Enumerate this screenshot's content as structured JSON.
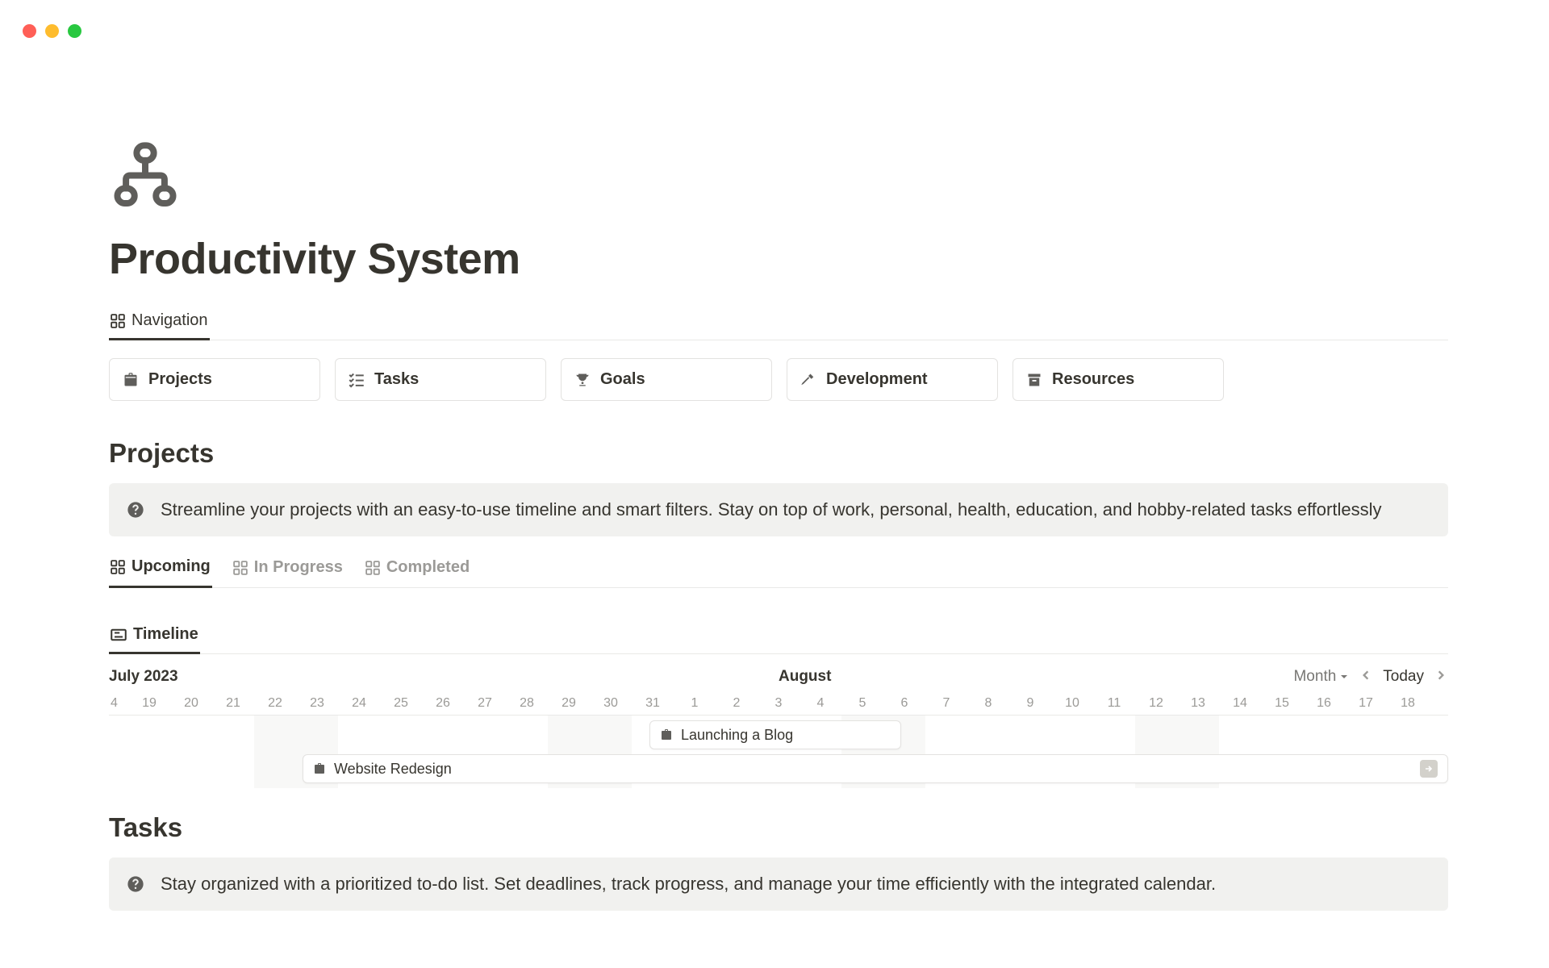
{
  "page": {
    "title": "Productivity System"
  },
  "nav_tab": {
    "label": "Navigation"
  },
  "cards": [
    {
      "label": "Projects"
    },
    {
      "label": "Tasks"
    },
    {
      "label": "Goals"
    },
    {
      "label": "Development"
    },
    {
      "label": "Resources"
    }
  ],
  "projects": {
    "heading": "Projects",
    "callout": "Streamline your projects with an easy-to-use timeline and smart filters. Stay on top of work, personal, health, education, and hobby-related tasks effortlessly",
    "views": [
      {
        "label": "Upcoming"
      },
      {
        "label": "In Progress"
      },
      {
        "label": "Completed"
      }
    ],
    "timeline_tab": {
      "label": "Timeline"
    },
    "timeline": {
      "month1": "July 2023",
      "month2": "August",
      "control_select": "Month",
      "control_today": "Today",
      "days_first": "4",
      "days": [
        "19",
        "20",
        "21",
        "22",
        "23",
        "24",
        "25",
        "26",
        "27",
        "28",
        "29",
        "30",
        "31",
        "1",
        "2",
        "3",
        "4",
        "5",
        "6",
        "7",
        "8",
        "9",
        "10",
        "11",
        "12",
        "13",
        "14",
        "15",
        "16",
        "17",
        "18"
      ],
      "bars": [
        {
          "label": "Launching a Blog"
        },
        {
          "label": "Website Redesign"
        }
      ]
    }
  },
  "tasks": {
    "heading": "Tasks",
    "callout": "Stay organized with a prioritized to-do list. Set deadlines, track progress, and manage your time efficiently with the integrated calendar."
  }
}
